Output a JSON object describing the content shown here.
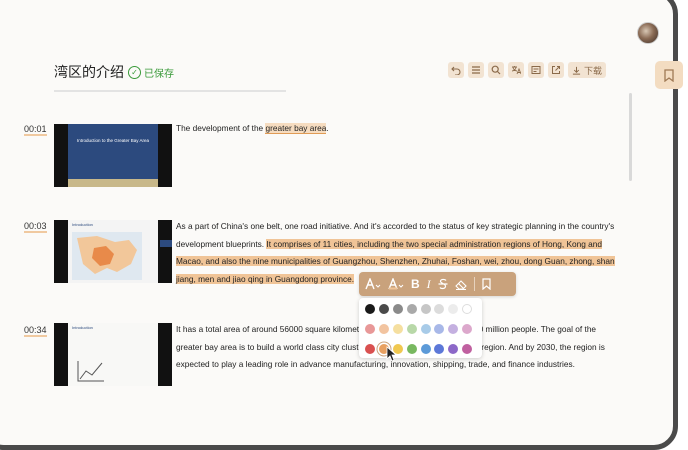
{
  "header": {
    "title": "湾区的介绍",
    "saved_label": "已保存",
    "toolbar": [
      {
        "name": "undo-icon"
      },
      {
        "name": "list-icon"
      },
      {
        "name": "search-icon"
      },
      {
        "name": "translate-icon"
      },
      {
        "name": "caption-icon"
      },
      {
        "name": "share-icon"
      },
      {
        "name": "download-icon",
        "label": "下载"
      }
    ]
  },
  "segments": [
    {
      "time": "00:01",
      "thumb_title": "Introduction to the Greater Bay Area"
    },
    {
      "time": "00:03",
      "thumb_title": "Introduction"
    },
    {
      "time": "00:34",
      "thumb_title": "Introduction"
    }
  ],
  "transcript": {
    "p1": {
      "a": "The development of the ",
      "b": "greater bay area",
      "c": "."
    },
    "p2": {
      "a": "As a part of China's one belt, one road initiative. And it's accorded to the status of key strategic planning in the country's development blueprints. ",
      "b": "It comprises of 11 cities, including the two special administration regions of Hong, Kong and Macao, and also the nine municipalities of Guangzhou, Shenzhen, Zhuhai, Foshan, wei, zhou, dong Guan, zhong, shan jiang, men and jiao qing in Guangdong province."
    },
    "p3": "It has a total area of around 56000 square kilometers and a population of around 70 million people. The goal of the greater bay area is to build a world class city cluster around the Hong Kong Macao region. And by 2030, the region is expected to play a leading role in advance manufacturing, innovation, shipping, trade, and finance industries."
  },
  "format_toolbar": {
    "buttons": [
      "font-size-icon",
      "font-color-icon",
      "bold-icon",
      "italic-icon",
      "strikethrough-icon",
      "eraser-icon",
      "bookmark-icon"
    ],
    "bold": "B",
    "italic": "I"
  },
  "palette": {
    "colors": [
      "#1a1a1a",
      "#4a4a4a",
      "#8a8a8a",
      "#a9a9a9",
      "#c6c6c6",
      "#dcdcdc",
      "#ececec",
      "#ffffff",
      "#e89898",
      "#f2c4a0",
      "#f5dfa0",
      "#b8d8a8",
      "#a8cbe8",
      "#a8b8e8",
      "#c4b0e0",
      "#dca8cc",
      "#d95050",
      "#e8a060",
      "#f0c850",
      "#78b860",
      "#5c9ad8",
      "#5c78d8",
      "#8c68c8",
      "#c060a0"
    ],
    "selected_index": 17
  }
}
